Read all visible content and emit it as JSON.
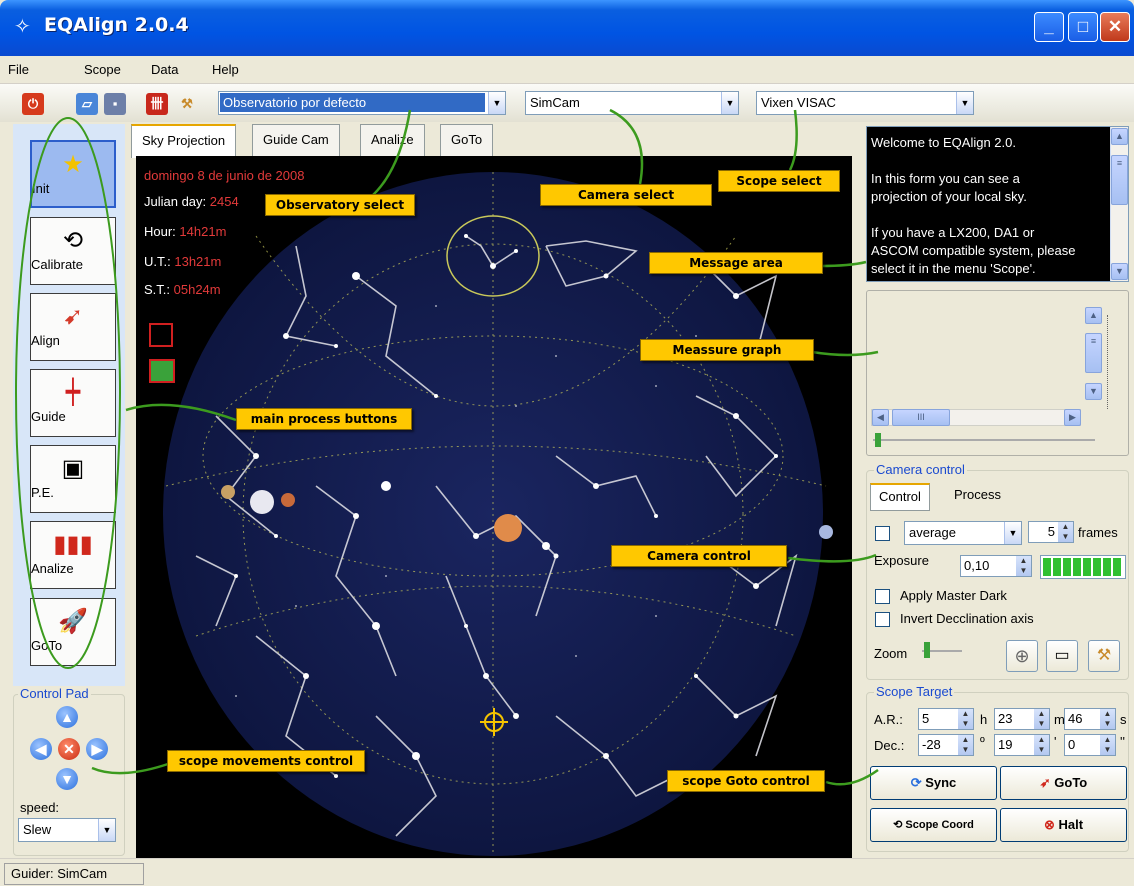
{
  "window": {
    "title": "EQAlign 2.0.4"
  },
  "menu": [
    "File",
    "Scope",
    "Data",
    "Help"
  ],
  "toolbar": {
    "observatory_value": "Observatorio por defecto",
    "camera_value": "SimCam",
    "scope_value": "Vixen VISAC"
  },
  "process_buttons": [
    "Init",
    "Calibrate",
    "Align",
    "Guide",
    "P.E.",
    "Analize",
    "GoTo"
  ],
  "control_pad": {
    "title": "Control Pad",
    "speed_label": "speed:",
    "speed_value": "Slew"
  },
  "tabs": [
    "Sky Projection",
    "Guide Cam",
    "Analize",
    "GoTo"
  ],
  "sky": {
    "date": "domingo 8 de junio de 2008",
    "julian_label": "Julian day:",
    "julian_value": "2454",
    "hour_label": "Hour:",
    "hour_value": "14h21m",
    "ut_label": "U.T.:",
    "ut_value": "13h21m",
    "st_label": "S.T.:",
    "st_value": "05h24m"
  },
  "messages": [
    "Welcome to EQAlign 2.0.",
    "",
    "In this form you can see a",
    "projection of your local sky.",
    "",
    "If you have a LX200, DA1 or",
    "ASCOM compatible system, please",
    "select it in the menu 'Scope'."
  ],
  "camera_control": {
    "title": "Camera control",
    "tabs": [
      "Control",
      "Process"
    ],
    "mode_value": "average",
    "frames_value": "5",
    "frames_label": "frames",
    "exposure_label": "Exposure",
    "exposure_value": "0,10",
    "apply_dark_label": "Apply Master Dark",
    "invert_label": "Invert Decclination axis",
    "zoom_label": "Zoom"
  },
  "scope_target": {
    "title": "Scope Target",
    "ar_label": "A.R.:",
    "ar_h": "5",
    "ar_h_unit": "h",
    "ar_m": "23",
    "ar_m_unit": "m",
    "ar_s": "46",
    "ar_s_unit": "s",
    "dec_label": "Dec.:",
    "dec_d": "-28",
    "dec_d_unit": "º",
    "dec_m": "19",
    "dec_m_unit": "'",
    "dec_s": "0",
    "dec_s_unit": "''",
    "sync_label": "Sync",
    "goto_label": "GoTo",
    "coord_label": "Scope Coord",
    "halt_label": "Halt"
  },
  "callouts": {
    "observatory": "Observatory select",
    "camera": "Camera select",
    "scope": "Scope select",
    "message": "Message area",
    "measure": "Meassure graph",
    "process": "main process buttons",
    "camera_control": "Camera control",
    "movements": "scope movements control",
    "goto": "scope Goto control"
  },
  "status": {
    "text": "Guider: SimCam"
  },
  "colors": {
    "titlebar": "#0054e3",
    "callout": "#ffc800",
    "sky": "#0f1746",
    "date_red": "#e23a3a",
    "annotation_green": "#3c9b1e"
  }
}
